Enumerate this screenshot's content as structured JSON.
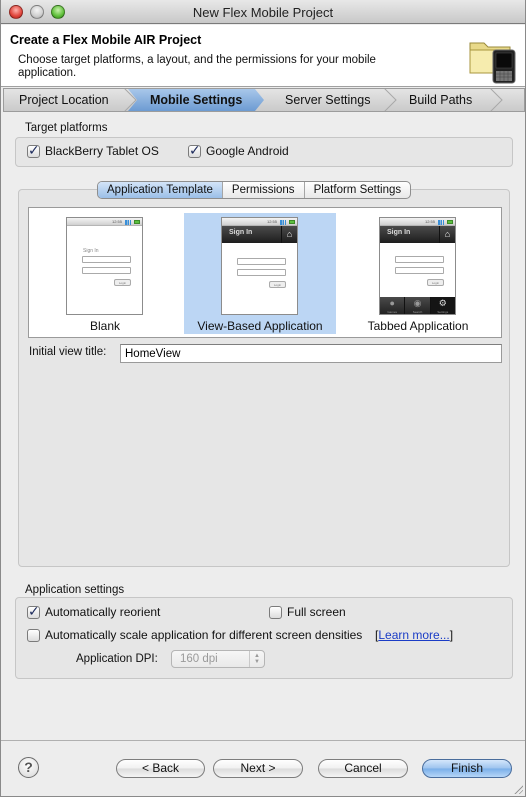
{
  "window": {
    "title": "New Flex Mobile Project"
  },
  "banner": {
    "title": "Create a Flex Mobile AIR Project",
    "description": "Choose target platforms, a layout, and the permissions for your mobile application.",
    "icon": "folder-with-phone-icon"
  },
  "steps": [
    {
      "label": "Project Location",
      "active": false
    },
    {
      "label": "Mobile Settings",
      "active": true
    },
    {
      "label": "Server Settings",
      "active": false
    },
    {
      "label": "Build Paths",
      "active": false
    }
  ],
  "target_platforms": {
    "label": "Target platforms",
    "options": [
      {
        "label": "BlackBerry Tablet OS",
        "checked": true
      },
      {
        "label": "Google Android",
        "checked": true
      }
    ]
  },
  "tabs": [
    {
      "label": "Application Template",
      "selected": true
    },
    {
      "label": "Permissions",
      "selected": false
    },
    {
      "label": "Platform Settings",
      "selected": false
    }
  ],
  "templates": [
    {
      "label": "Blank",
      "selected": false,
      "preview": {
        "status_time": "12:55",
        "title": "",
        "signin_label": "Sign In",
        "button": "Login"
      }
    },
    {
      "label": "View-Based Application",
      "selected": true,
      "preview": {
        "status_time": "12:55",
        "title": "Sign In",
        "signin_label": "",
        "button": "Login"
      }
    },
    {
      "label": "Tabbed Application",
      "selected": false,
      "preview": {
        "status_time": "12:55",
        "title": "Sign In",
        "signin_label": "",
        "button": "Login",
        "tabs": [
          "Games",
          "Search",
          "Settings"
        ]
      }
    }
  ],
  "initial_view": {
    "label": "Initial view title:",
    "value": "HomeView"
  },
  "app_settings": {
    "label": "Application settings",
    "auto_reorient": {
      "label": "Automatically reorient",
      "checked": true
    },
    "full_screen": {
      "label": "Full screen",
      "checked": false
    },
    "auto_scale": {
      "label": "Automatically scale application for different screen densities",
      "checked": false
    },
    "learn_more": "Learn more...",
    "dpi_label": "Application DPI:",
    "dpi_value": "160 dpi"
  },
  "footer": {
    "help_glyph": "?",
    "back": "< Back",
    "next": "Next >",
    "cancel": "Cancel",
    "finish": "Finish"
  },
  "glyphs": {
    "check": "✓",
    "home": "⌂",
    "gamepad": "🎮",
    "search": "◉",
    "gear": "⚙",
    "up_down": "▲▼"
  }
}
